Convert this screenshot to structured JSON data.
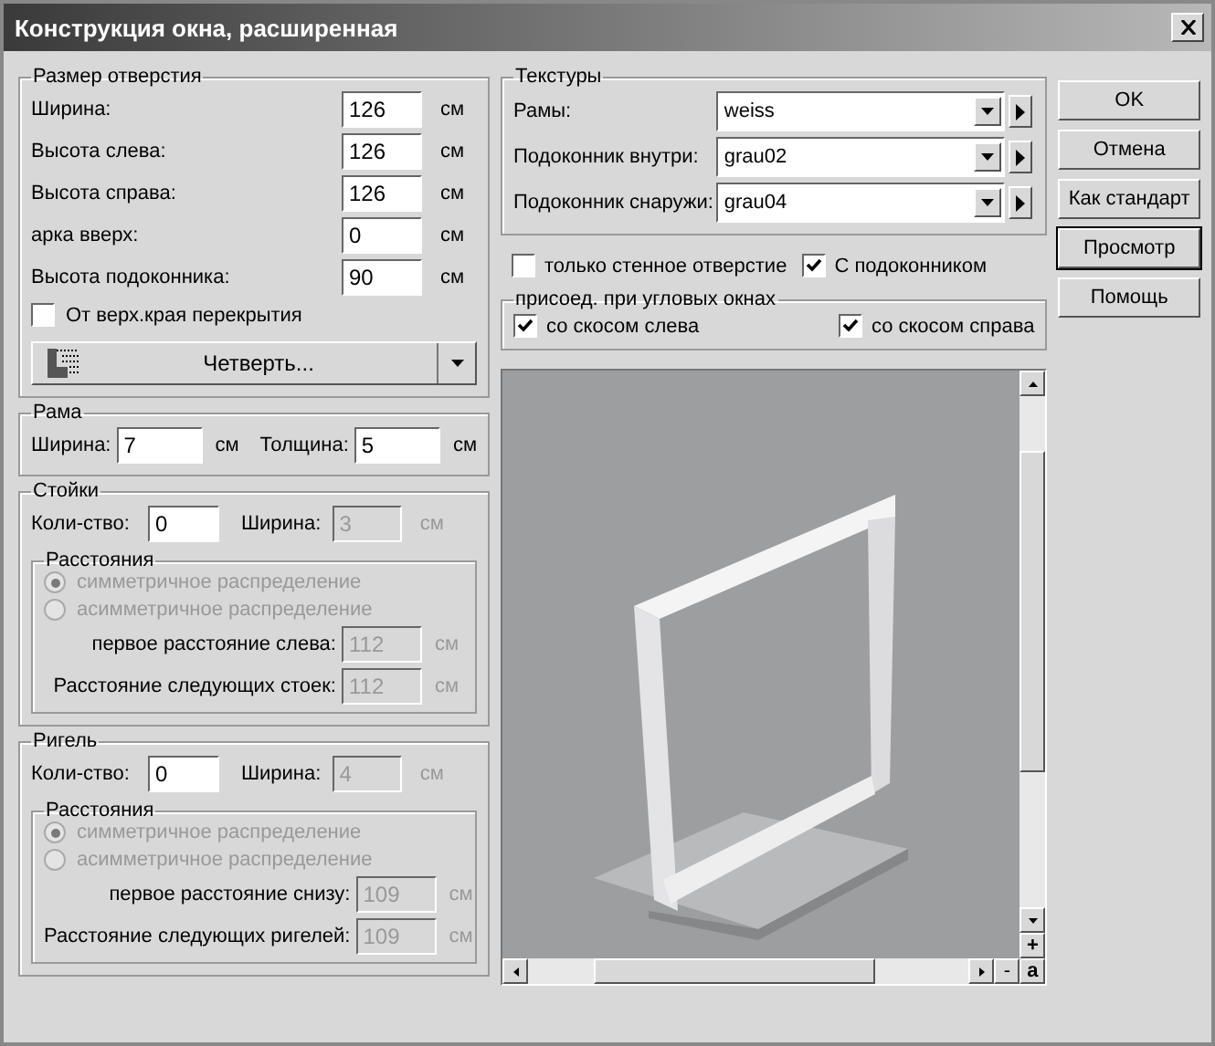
{
  "window": {
    "title": "Конструкция окна, расширенная"
  },
  "opening": {
    "title": "Размер отверстия",
    "fields": [
      {
        "label": "Ширина:",
        "value": "126",
        "unit": "см"
      },
      {
        "label": "Высота слева:",
        "value": "126",
        "unit": "см"
      },
      {
        "label": "Высота справа:",
        "value": "126",
        "unit": "см"
      },
      {
        "label": "арка вверх:",
        "value": "0",
        "unit": "см"
      },
      {
        "label": "Высота подоконника:",
        "value": "90",
        "unit": "см"
      }
    ],
    "from_top": {
      "label": "От верх.края перекрытия",
      "checked": false
    },
    "profile": {
      "value": "Четверть..."
    }
  },
  "frame": {
    "title": "Рама",
    "width": {
      "label": "Ширина:",
      "value": "7",
      "unit": "см"
    },
    "thickness": {
      "label": "Толщина:",
      "value": "5",
      "unit": "см"
    }
  },
  "sections": [
    {
      "title": "Стойки",
      "count": {
        "label": "Коли-ство:",
        "value": "0"
      },
      "width": {
        "label": "Ширина:",
        "value": "3",
        "unit": "см",
        "disabled": true
      },
      "distances": {
        "title": "Расстояния",
        "options": [
          {
            "label": "симметричное распределение",
            "selected": true,
            "disabled": true
          },
          {
            "label": "асимметричное распределение",
            "selected": false,
            "disabled": true
          }
        ],
        "fields": [
          {
            "label": "первое расстояние слева:",
            "value": "112",
            "unit": "см",
            "disabled": true
          },
          {
            "label": "Расстояние следующих стоек:",
            "value": "112",
            "unit": "см",
            "disabled": true
          }
        ]
      }
    },
    {
      "title": "Ригель",
      "count": {
        "label": "Коли-ство:",
        "value": "0"
      },
      "width": {
        "label": "Ширина:",
        "value": "4",
        "unit": "см",
        "disabled": true
      },
      "distances": {
        "title": "Расстояния",
        "options": [
          {
            "label": "симметричное распределение",
            "selected": true,
            "disabled": true
          },
          {
            "label": "асимметричное распределение",
            "selected": false,
            "disabled": true
          }
        ],
        "fields": [
          {
            "label": "первое расстояние снизу:",
            "value": "109",
            "unit": "см",
            "disabled": true
          },
          {
            "label": "Расстояние следующих ригелей:",
            "value": "109",
            "unit": "см",
            "disabled": true
          }
        ]
      }
    }
  ],
  "textures": {
    "title": "Текстуры",
    "rows": [
      {
        "label": "Рамы:",
        "value": "weiss"
      },
      {
        "label": "Подоконник внутри:",
        "value": "grau02"
      },
      {
        "label": "Подоконник снаружи:",
        "value": "grau04"
      }
    ]
  },
  "options": [
    {
      "label": "только стенное отверстие",
      "checked": false
    },
    {
      "label": "С подоконником",
      "checked": true
    }
  ],
  "corner": {
    "title": "присоед. при угловых окнах",
    "options": [
      {
        "label": "со скосом слева",
        "checked": true
      },
      {
        "label": "со скосом справа",
        "checked": true
      }
    ]
  },
  "preview": {
    "zoom_in": "+",
    "zoom_out": "-",
    "fit": "a"
  },
  "buttons": [
    {
      "label": "OK",
      "focused": false
    },
    {
      "label": "Отмена",
      "focused": false
    },
    {
      "label": "Как стандарт",
      "focused": false
    },
    {
      "label": "Просмотр",
      "focused": true
    },
    {
      "label": "Помощь",
      "focused": false
    }
  ]
}
